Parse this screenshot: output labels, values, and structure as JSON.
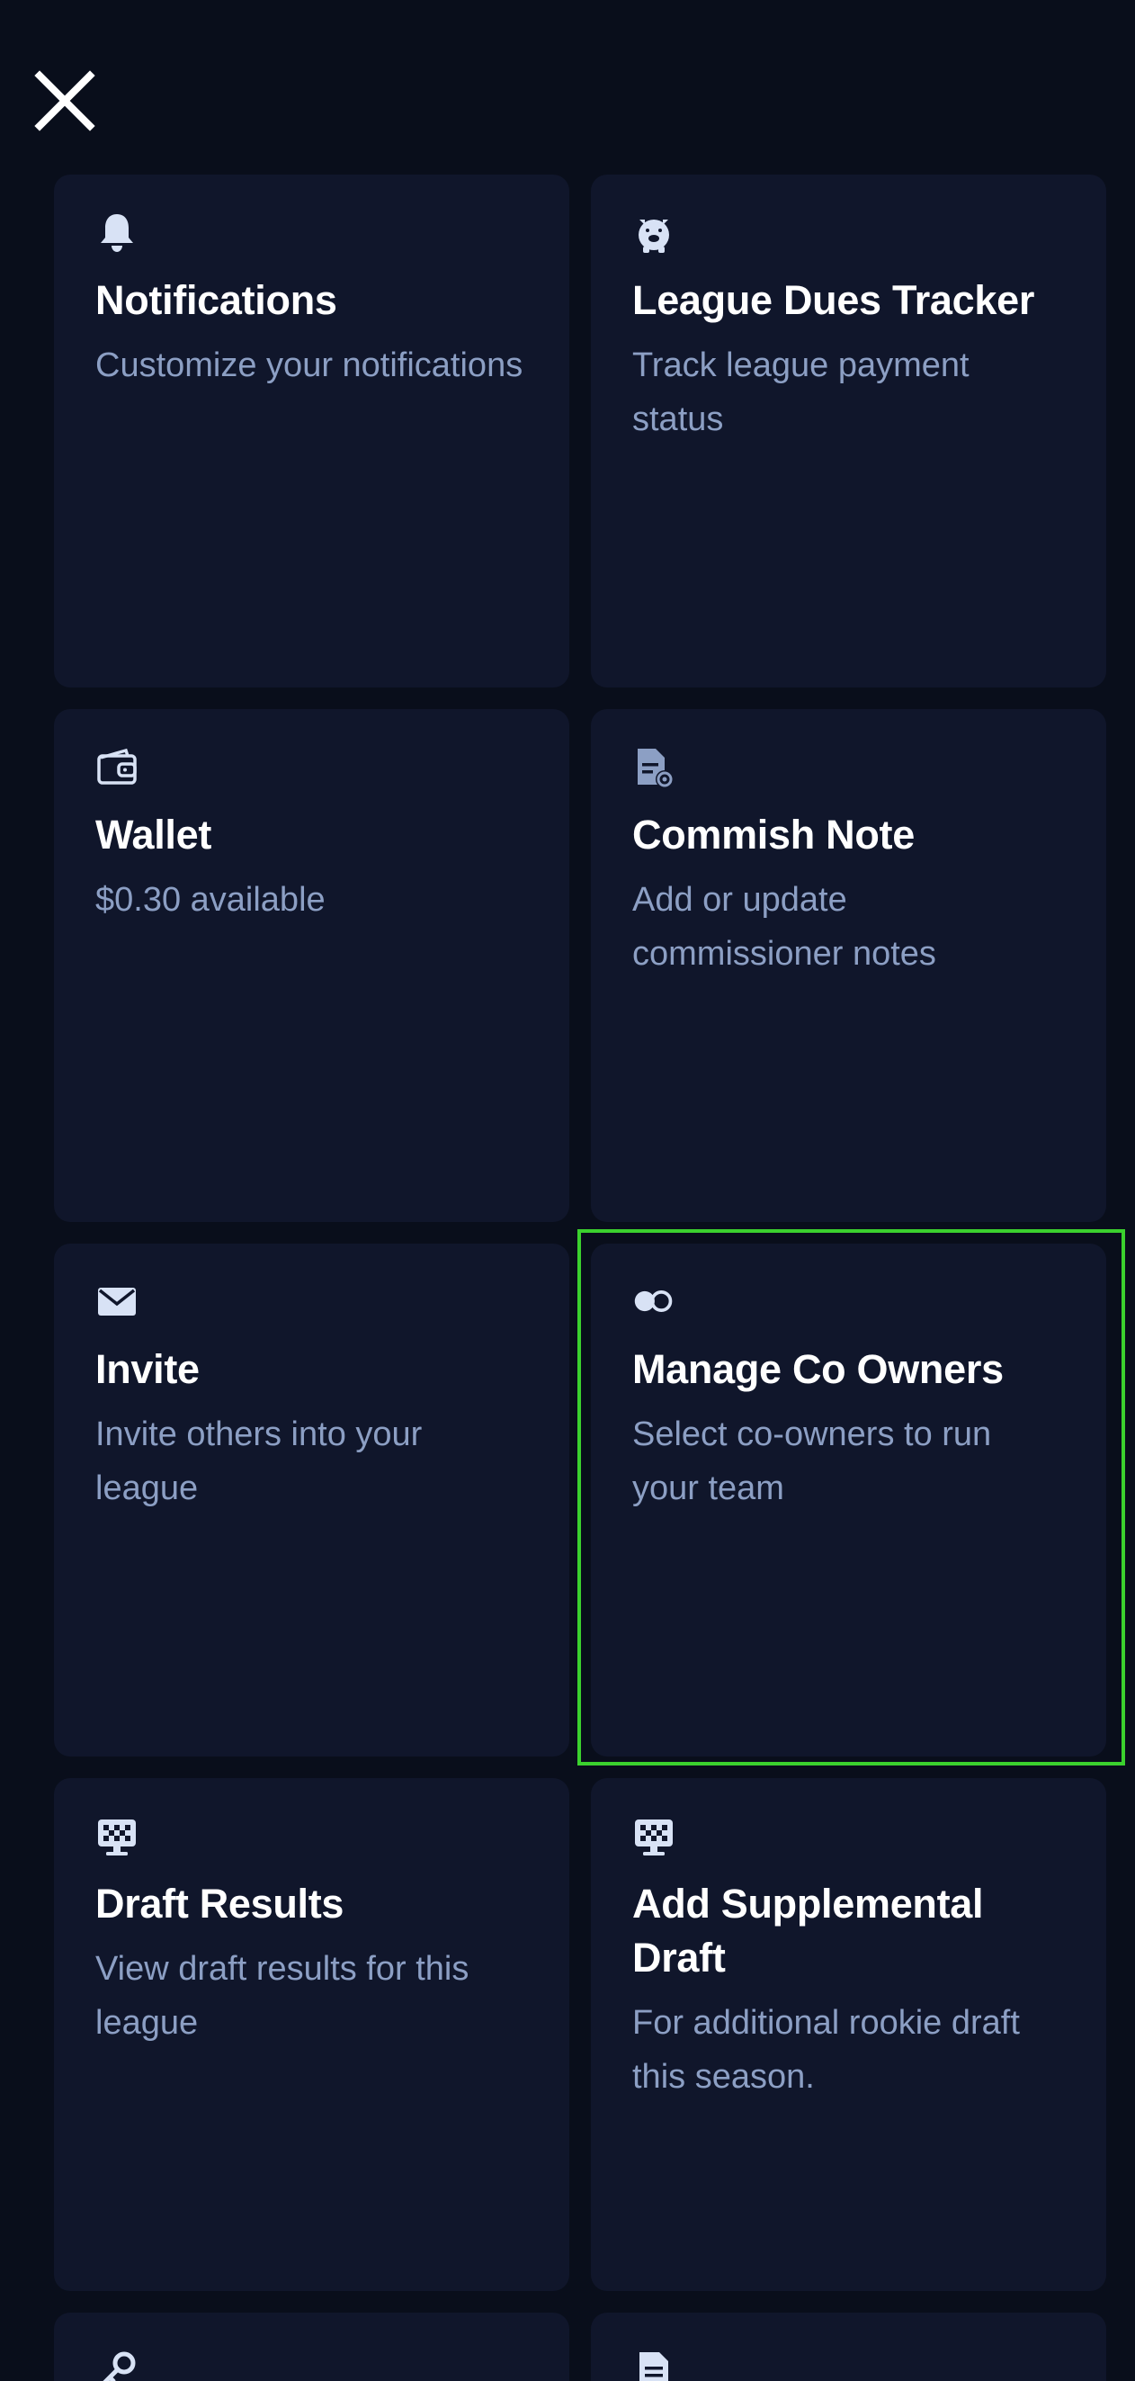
{
  "menu": {
    "close_icon": "close-icon",
    "cards": [
      {
        "id": "notifications",
        "icon": "bell-icon",
        "title": "Notifications",
        "description": "Customize your notifications"
      },
      {
        "id": "league-dues-tracker",
        "icon": "piggy-bank-icon",
        "title": "League Dues Tracker",
        "description": "Track league payment status"
      },
      {
        "id": "wallet",
        "icon": "wallet-icon",
        "title": "Wallet",
        "description": "$0.30 available"
      },
      {
        "id": "commish-note",
        "icon": "note-icon",
        "title": "Commish Note",
        "description": "Add or update commissioner notes"
      },
      {
        "id": "invite",
        "icon": "envelope-icon",
        "title": "Invite",
        "description": "Invite others into your league"
      },
      {
        "id": "manage-co-owners",
        "icon": "co-owners-icon",
        "title": "Manage Co Owners",
        "description": "Select co-owners to run your team"
      },
      {
        "id": "draft-results",
        "icon": "draft-board-icon",
        "title": "Draft Results",
        "description": "View draft results for this league"
      },
      {
        "id": "add-supplemental-draft",
        "icon": "draft-board-icon",
        "title": "Add Supplemental Draft",
        "description": "For additional rookie draft this season."
      },
      {
        "id": "partial-left",
        "icon": "key-icon"
      },
      {
        "id": "partial-right",
        "icon": "document-icon"
      }
    ]
  },
  "colors": {
    "background": "#090e1b",
    "card": "#10162b",
    "title": "#ffffff",
    "description": "#8c9fc4",
    "icon": "#d8e2f5",
    "highlight": "#3bd12e"
  }
}
